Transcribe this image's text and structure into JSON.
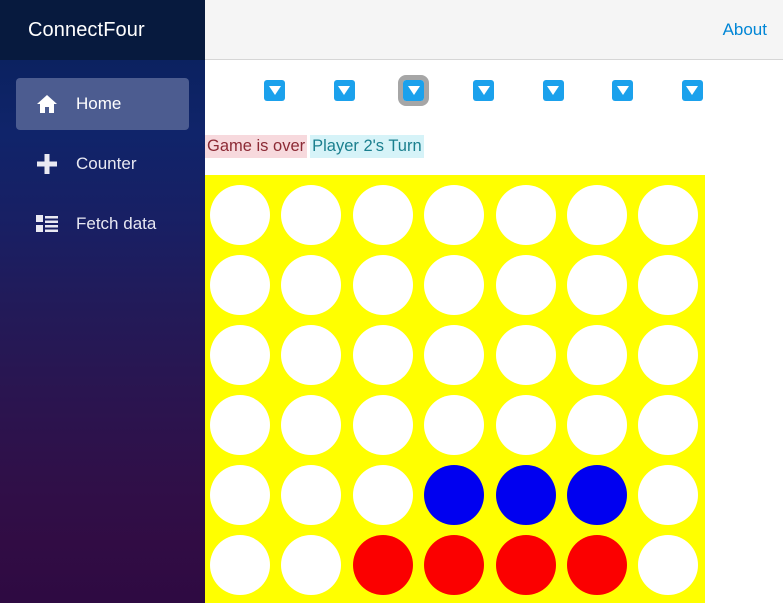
{
  "brand": {
    "title": "ConnectFour"
  },
  "topbar": {
    "about_label": "About"
  },
  "sidebar": {
    "items": [
      {
        "label": "Home",
        "icon": "home-icon",
        "active": true
      },
      {
        "label": "Counter",
        "icon": "plus-icon",
        "active": false
      },
      {
        "label": "Fetch data",
        "icon": "list-icon",
        "active": false
      }
    ]
  },
  "game": {
    "columns": 7,
    "rows": 6,
    "drop_button_icon": "triangle-down-icon",
    "drop_button_labels": [
      "Drop in column 1",
      "Drop in column 2",
      "Drop in column 3",
      "Drop in column 4",
      "Drop in column 5",
      "Drop in column 6",
      "Drop in column 7"
    ],
    "focused_drop_column": 3,
    "status": {
      "game_over_label": "Game is over",
      "turn_label": "Player 2's Turn"
    },
    "colors": {
      "board": "#ffff00",
      "empty": "#ffffff",
      "player1": "#fb0000",
      "player2": "#0000f0",
      "accent": "#1ba1ec",
      "link": "#0086d6"
    },
    "board": [
      [
        "empty",
        "empty",
        "empty",
        "empty",
        "empty",
        "empty",
        "empty"
      ],
      [
        "empty",
        "empty",
        "empty",
        "empty",
        "empty",
        "empty",
        "empty"
      ],
      [
        "empty",
        "empty",
        "empty",
        "empty",
        "empty",
        "empty",
        "empty"
      ],
      [
        "empty",
        "empty",
        "empty",
        "empty",
        "empty",
        "empty",
        "empty"
      ],
      [
        "empty",
        "empty",
        "empty",
        "blue",
        "blue",
        "blue",
        "empty"
      ],
      [
        "empty",
        "empty",
        "red",
        "red",
        "red",
        "red",
        "empty"
      ]
    ]
  }
}
